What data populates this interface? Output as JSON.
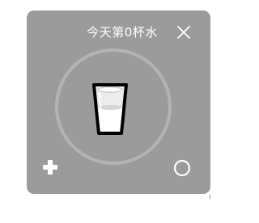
{
  "widget": {
    "title": "今天第0杯水",
    "cups_today": 0,
    "background_color": "#9b9b9b",
    "text_color": "#ffffff"
  },
  "icons": {
    "close": "close-icon",
    "cup": "water-glass-icon",
    "add": "plus-icon",
    "settings": "circle-icon"
  }
}
